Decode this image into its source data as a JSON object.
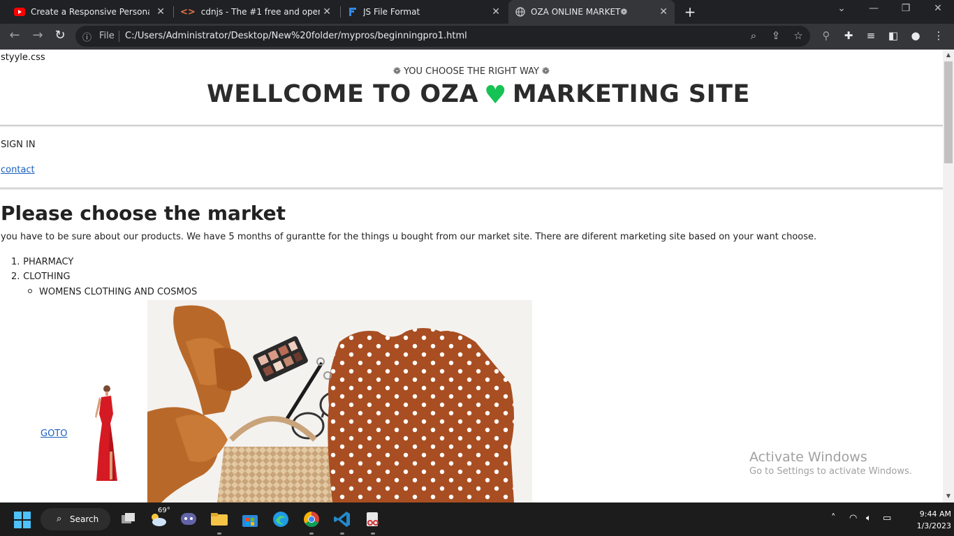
{
  "browser": {
    "tabs": [
      {
        "title": "Create a Responsive Personal Por",
        "icon": "youtube-icon"
      },
      {
        "title": "cdnjs - The #1 free and open sou",
        "icon": "code-icon"
      },
      {
        "title": "JS File Format",
        "icon": "flag-icon"
      },
      {
        "title": "OZA ONLINE MARKET❁",
        "icon": "globe-icon",
        "active": true
      }
    ],
    "new_tab": "+",
    "address": {
      "scheme_label": "File",
      "url": "C:/Users/Administrator/Desktop/New%20folder/mypros/beginningpro1.html"
    }
  },
  "page": {
    "stylesheet_text": "styyle.css",
    "tagline": "❁ YOU CHOOSE THE RIGHT WAY ❁",
    "title_part1": "WELLCOME TO OZA",
    "title_heart": "♥",
    "title_part2": "MARKETING SITE",
    "signin": "SIGN IN",
    "contact": "contact",
    "heading": "Please choose the market",
    "intro": "you have to be sure about our products. We have 5 months of gurantte for the things u bought from our market site. There are diferent marketing site based on your want choose.",
    "list": [
      {
        "num": "1.",
        "label": "PHARMACY"
      },
      {
        "num": "2.",
        "label": "CLOTHING"
      }
    ],
    "sublist": [
      "WOMENS CLOTHING AND COSMOS"
    ],
    "goto": "GOTO",
    "heart_color": "#16c253",
    "link_color": "#1a5fbf"
  },
  "watermark": {
    "title": "Activate Windows",
    "subtitle": "Go to Settings to activate Windows."
  },
  "taskbar": {
    "search_label": "Search",
    "weather_temp": "69°",
    "time": "9:44 AM",
    "date": "1/3/2023"
  }
}
